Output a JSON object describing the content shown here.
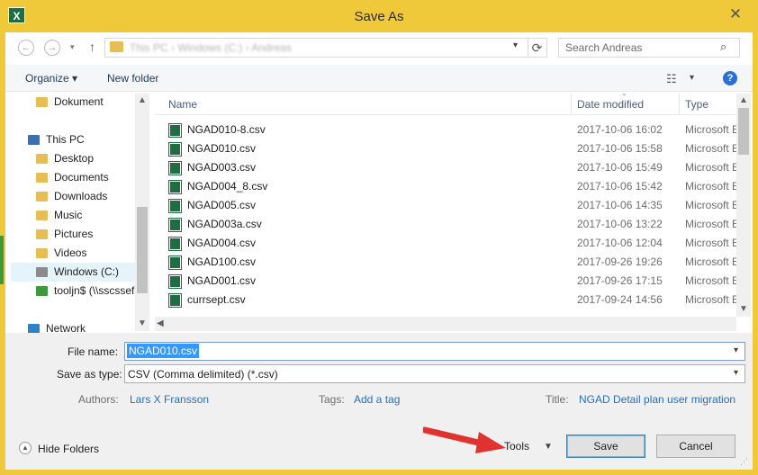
{
  "window": {
    "title": "Save As",
    "app_icon": "excel-icon",
    "accent": "#f0c93a"
  },
  "address": {
    "path_blurred": "This PC  ›  Windows (C:)  ›  Andreas",
    "search_placeholder": "Search Andreas"
  },
  "toolbar": {
    "organize": "Organize",
    "new_folder": "New folder"
  },
  "nav": {
    "items": [
      {
        "label": "Dokument",
        "icon": "folder-icon"
      },
      {
        "label": "This PC",
        "icon": "computer-icon"
      },
      {
        "label": "Desktop",
        "icon": "folder-icon"
      },
      {
        "label": "Documents",
        "icon": "folder-icon"
      },
      {
        "label": "Downloads",
        "icon": "folder-icon"
      },
      {
        "label": "Music",
        "icon": "folder-icon"
      },
      {
        "label": "Pictures",
        "icon": "folder-icon"
      },
      {
        "label": "Videos",
        "icon": "folder-icon"
      },
      {
        "label": "Windows (C:)",
        "icon": "drive-icon"
      },
      {
        "label": "tooljn$ (\\\\sscssef",
        "icon": "network-drive-icon"
      },
      {
        "label": "Network",
        "icon": "network-icon"
      }
    ]
  },
  "files": {
    "columns": {
      "name": "Name",
      "date": "Date modified",
      "type": "Type"
    },
    "rows": [
      {
        "name": "NGAD010-8.csv",
        "date": "2017-10-06 16:02",
        "type": "Microsoft Excel"
      },
      {
        "name": "NGAD010.csv",
        "date": "2017-10-06 15:58",
        "type": "Microsoft Excel"
      },
      {
        "name": "NGAD003.csv",
        "date": "2017-10-06 15:49",
        "type": "Microsoft Excel"
      },
      {
        "name": "NGAD004_8.csv",
        "date": "2017-10-06 15:42",
        "type": "Microsoft Excel"
      },
      {
        "name": "NGAD005.csv",
        "date": "2017-10-06 14:35",
        "type": "Microsoft Excel"
      },
      {
        "name": "NGAD003a.csv",
        "date": "2017-10-06 13:22",
        "type": "Microsoft Excel"
      },
      {
        "name": "NGAD004.csv",
        "date": "2017-10-06 12:04",
        "type": "Microsoft Excel"
      },
      {
        "name": "NGAD100.csv",
        "date": "2017-09-26 19:26",
        "type": "Microsoft Excel"
      },
      {
        "name": "NGAD001.csv",
        "date": "2017-09-26 17:15",
        "type": "Microsoft Excel"
      },
      {
        "name": "currsept.csv",
        "date": "2017-09-24 14:56",
        "type": "Microsoft Excel"
      }
    ]
  },
  "form": {
    "file_name_label": "File name:",
    "file_name_value": "NGAD010.csv",
    "save_type_label": "Save as type:",
    "save_type_value": "CSV (Comma delimited) (*.csv)",
    "authors_label": "Authors:",
    "authors_value": "Lars X Fransson",
    "tags_label": "Tags:",
    "tags_value": "Add a tag",
    "title_label": "Title:",
    "title_value": "NGAD Detail plan user migration"
  },
  "footer": {
    "hide_folders": "Hide Folders",
    "tools": "Tools",
    "save": "Save",
    "cancel": "Cancel"
  }
}
